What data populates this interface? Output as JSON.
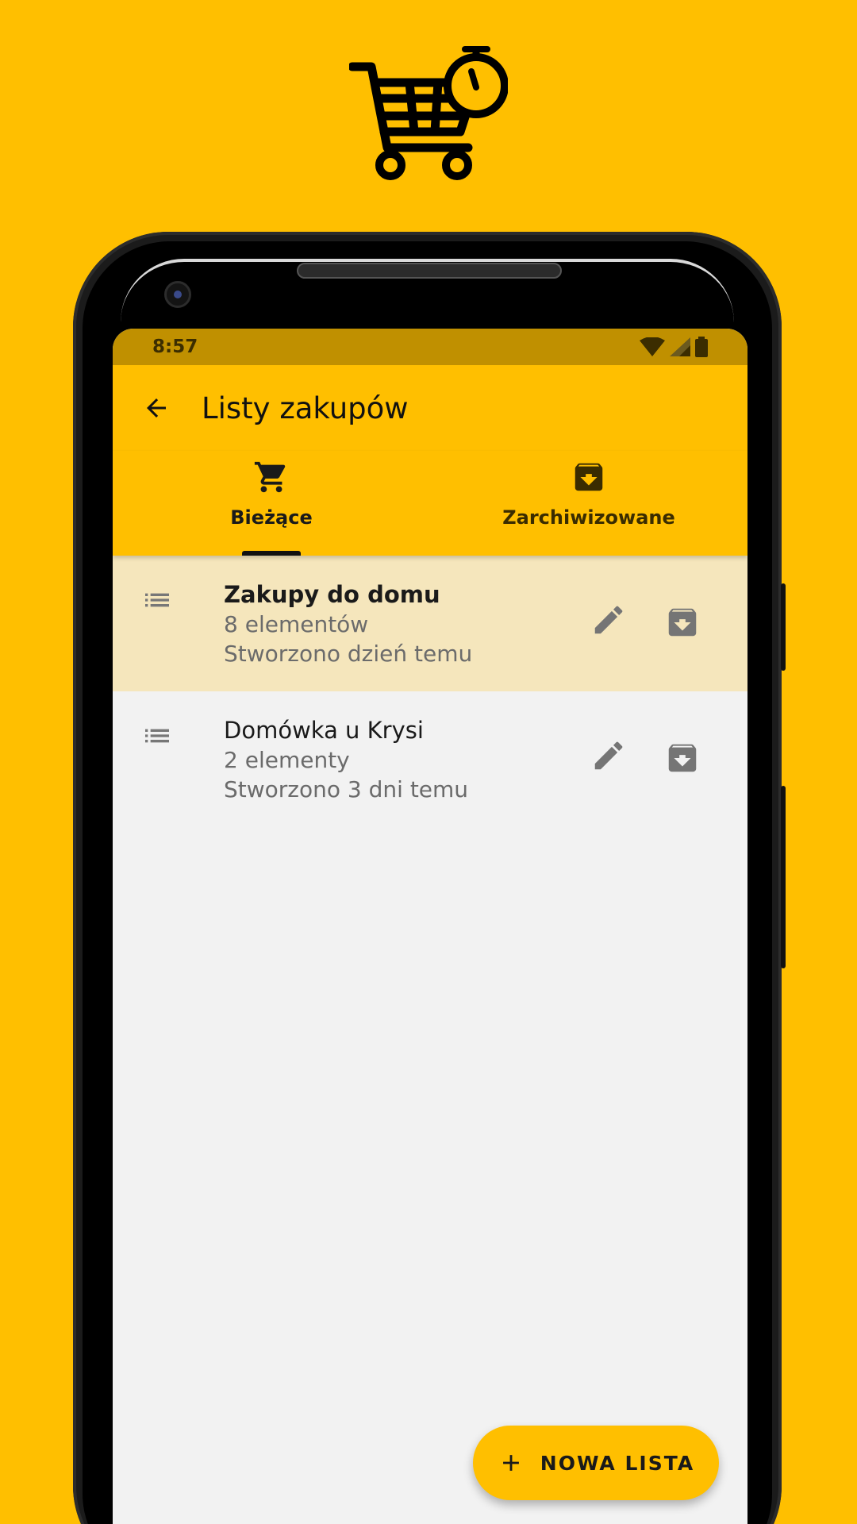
{
  "colors": {
    "accent": "#FFBF00",
    "statusbar": "#C09000",
    "selected_row": "#F5E6BC",
    "background": "#F2F2F2"
  },
  "statusbar": {
    "time": "8:57"
  },
  "appbar": {
    "title": "Listy zakupów",
    "back_icon": "arrow-back-icon"
  },
  "tabs": [
    {
      "label": "Bieżące",
      "icon": "cart-icon",
      "selected": true
    },
    {
      "label": "Zarchiwizowane",
      "icon": "archive-icon",
      "selected": false
    }
  ],
  "lists": [
    {
      "title": "Zakupy do domu",
      "count": "8 elementów",
      "created": "Stworzono dzień temu",
      "selected": true
    },
    {
      "title": "Domówka u Krysi",
      "count": "2 elementy",
      "created": "Stworzono 3 dni temu",
      "selected": false
    }
  ],
  "fab": {
    "label": "NOWA LISTA",
    "icon": "plus-icon"
  }
}
